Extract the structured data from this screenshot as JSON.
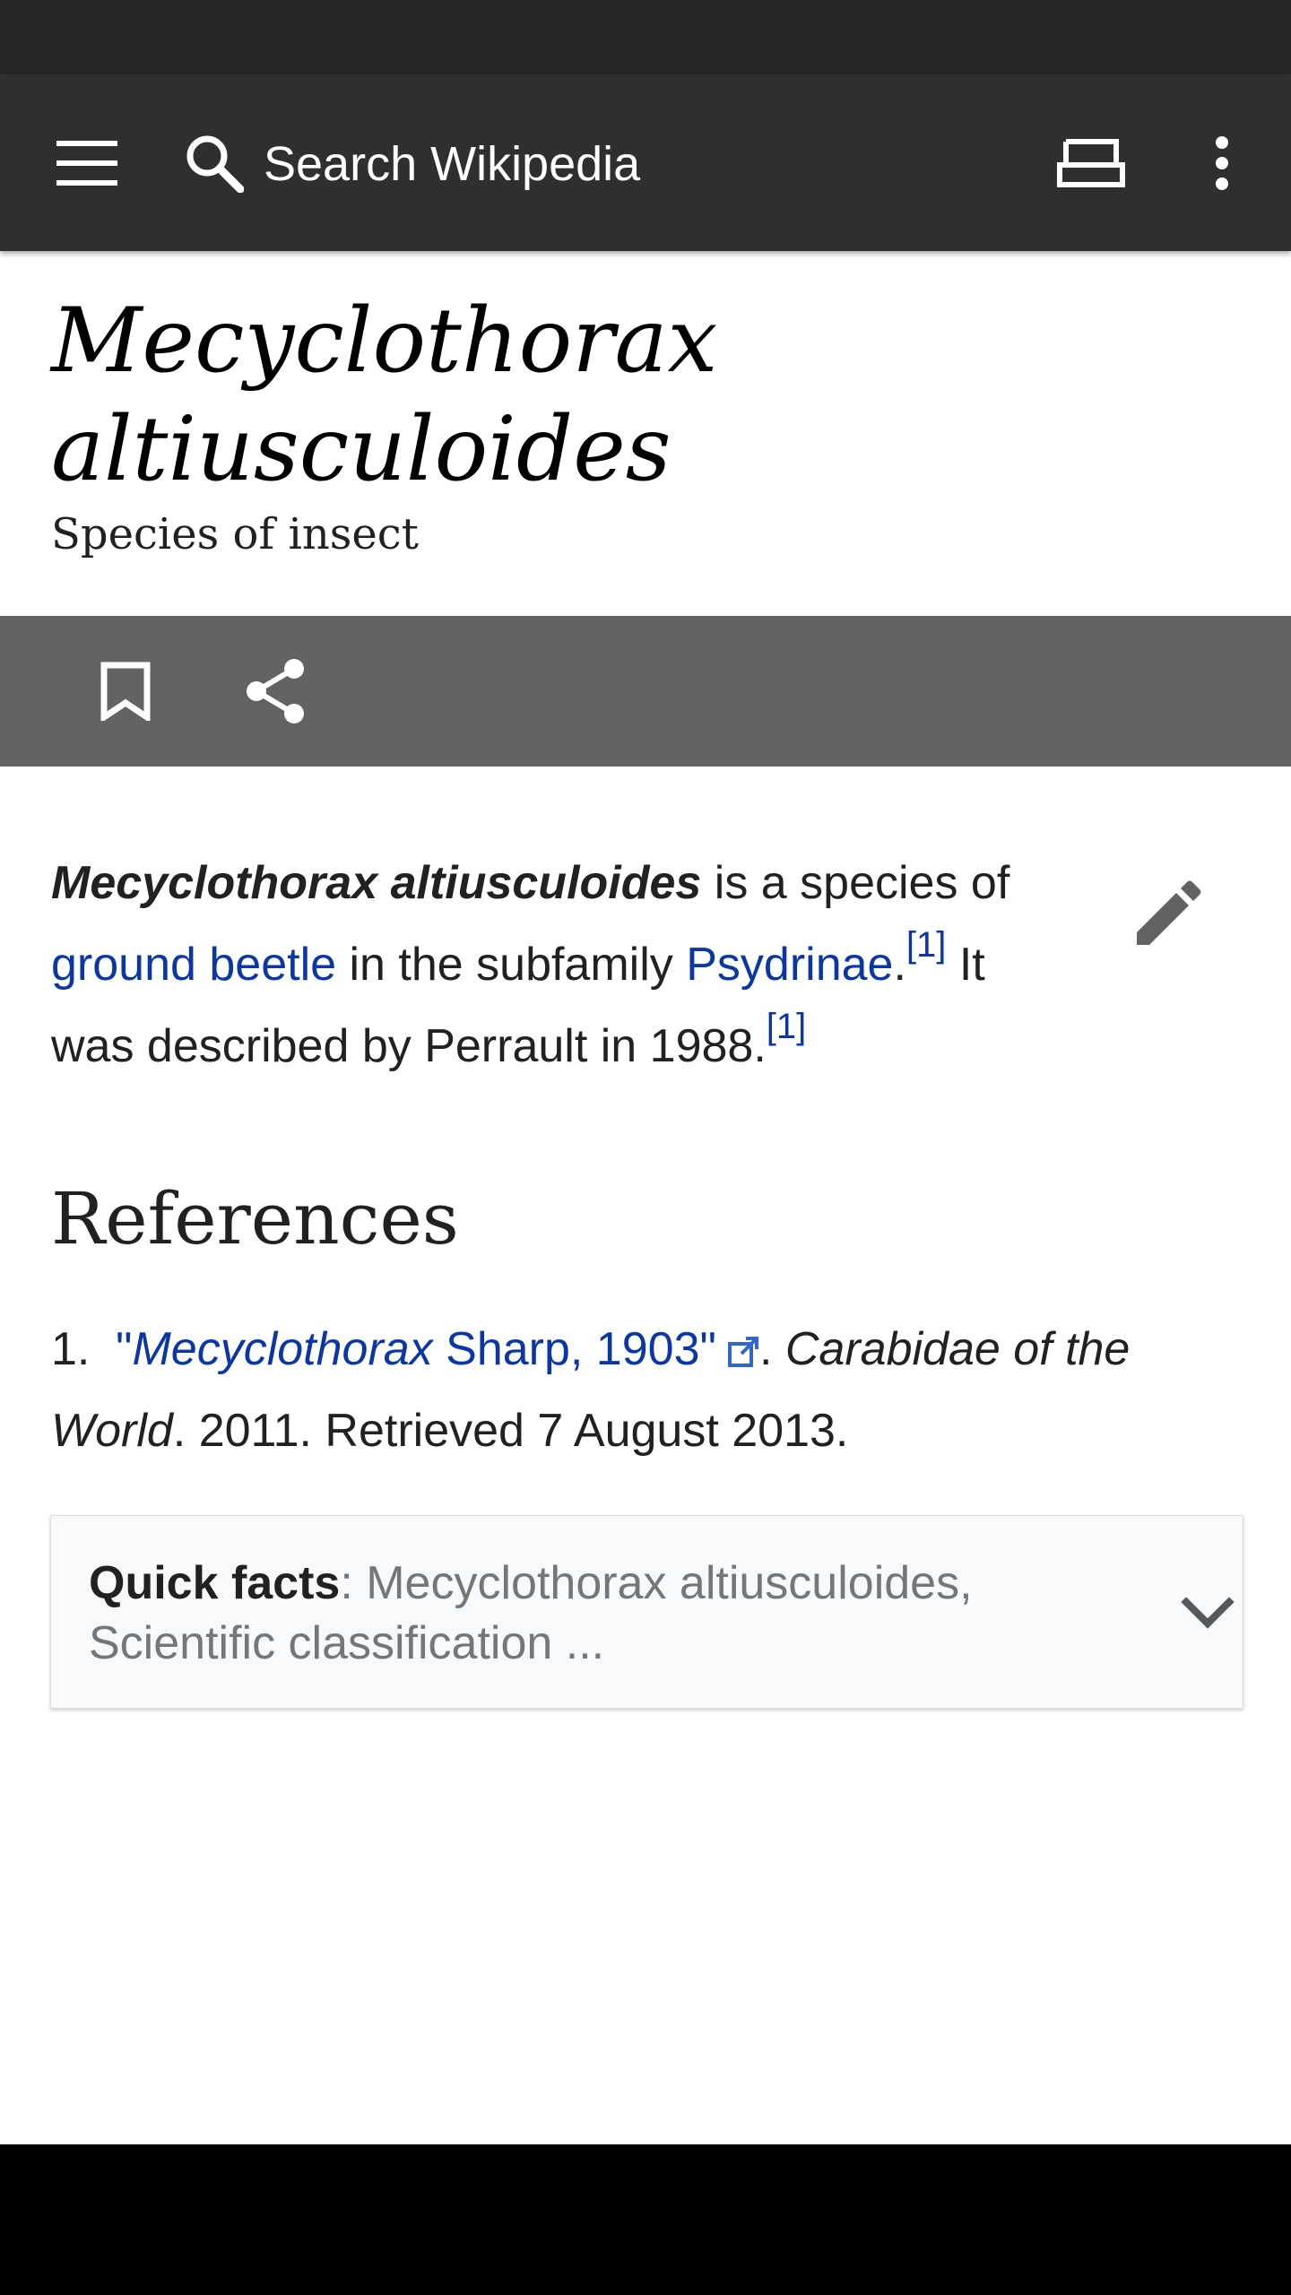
{
  "toolbar": {
    "search_placeholder": "Search Wikipedia",
    "icons": [
      "menu-icon",
      "search-icon",
      "tabs-icon",
      "overflow-menu-icon"
    ]
  },
  "article": {
    "title_line1": "Mecyclothorax",
    "title_line2": "altiusculoides",
    "description": "Species of insect",
    "intro": {
      "bold_name": "Mecyclothorax altiusculoides",
      "text_1": " is a species of ",
      "link_ground_beetle": "ground beetle",
      "text_2": " in the subfamily ",
      "link_psydrinae": "Psydrinae",
      "text_3": ".",
      "cite_1": "[1]",
      "text_4": " It was described by Perrault in 1988.",
      "cite_2": "[1]"
    }
  },
  "references": {
    "heading": "References",
    "items": [
      {
        "number": "1.",
        "quote_open": "\"",
        "link_italic": "Mecyclothorax",
        "link_rest": " Sharp, 1903",
        "quote_close": "\"",
        "after_link": ". ",
        "work": "Carabidae of the World",
        "details": ". 2011. Retrieved 7 August 2013."
      }
    ]
  },
  "quick_facts": {
    "label": "Quick facts",
    "summary": ": Mecyclothorax altiusculoides, Scientific classification ..."
  },
  "colors": {
    "toolbar": "#2f2f2f",
    "status_bar": "#262626",
    "action_bar": "#636363",
    "link": "#0b37a5",
    "text": "#202122"
  }
}
